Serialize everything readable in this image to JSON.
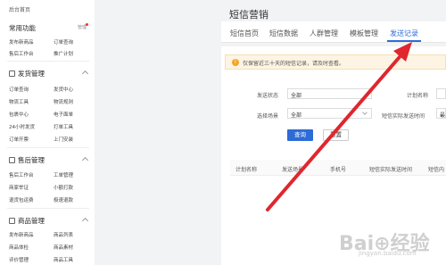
{
  "sidebar": {
    "back": "后台首页",
    "common": {
      "title": "常用功能",
      "settings": "管理",
      "items": [
        "发布新商品",
        "订单查询",
        "售后工作台",
        "推广计划"
      ]
    },
    "shipping": {
      "title": "发货管理",
      "items": [
        "订单查询",
        "发货中心",
        "物流工具",
        "物流规则",
        "包裹中心",
        "电子面单",
        "24小时发货",
        "打单工具",
        "订单开票",
        "上门安装"
      ]
    },
    "aftersale": {
      "title": "售后管理",
      "items": [
        "售后工作台",
        "工单管理",
        "商家举证",
        "小额打款",
        "退货包运费",
        "极速退款"
      ]
    },
    "goods": {
      "title": "商品管理",
      "items": [
        "发布新商品",
        "商品列表",
        "商品体检",
        "商品素材",
        "评价管理",
        "商品工具"
      ]
    }
  },
  "main": {
    "title": "短信营销",
    "tabs": [
      "短信首页",
      "短信数据",
      "人群管理",
      "模板管理",
      "发送记录"
    ],
    "active_tab": "发送记录",
    "alert": "仅保留近三十天的短信记录，请及时查看。",
    "form": {
      "send_status_label": "发送状态",
      "send_status_value": "全部",
      "plan_name_label": "计划名称",
      "scene_label": "选择场景",
      "scene_value": "全部",
      "actual_time_label": "短信实际发送时间",
      "actual_time_value": "最",
      "query_button": "查询",
      "reset_button": "重置"
    },
    "table_headers": [
      "计划名称",
      "发送场景",
      "手机号",
      "短信实际发送时间",
      "短信内"
    ]
  },
  "watermark": "Bai⊕经验",
  "watermark_sub": "jingyan.baidu.com",
  "colors": {
    "accent": "#2d6bd6",
    "arrow": "#e0262e",
    "alert_bg": "#fdf4e3"
  }
}
